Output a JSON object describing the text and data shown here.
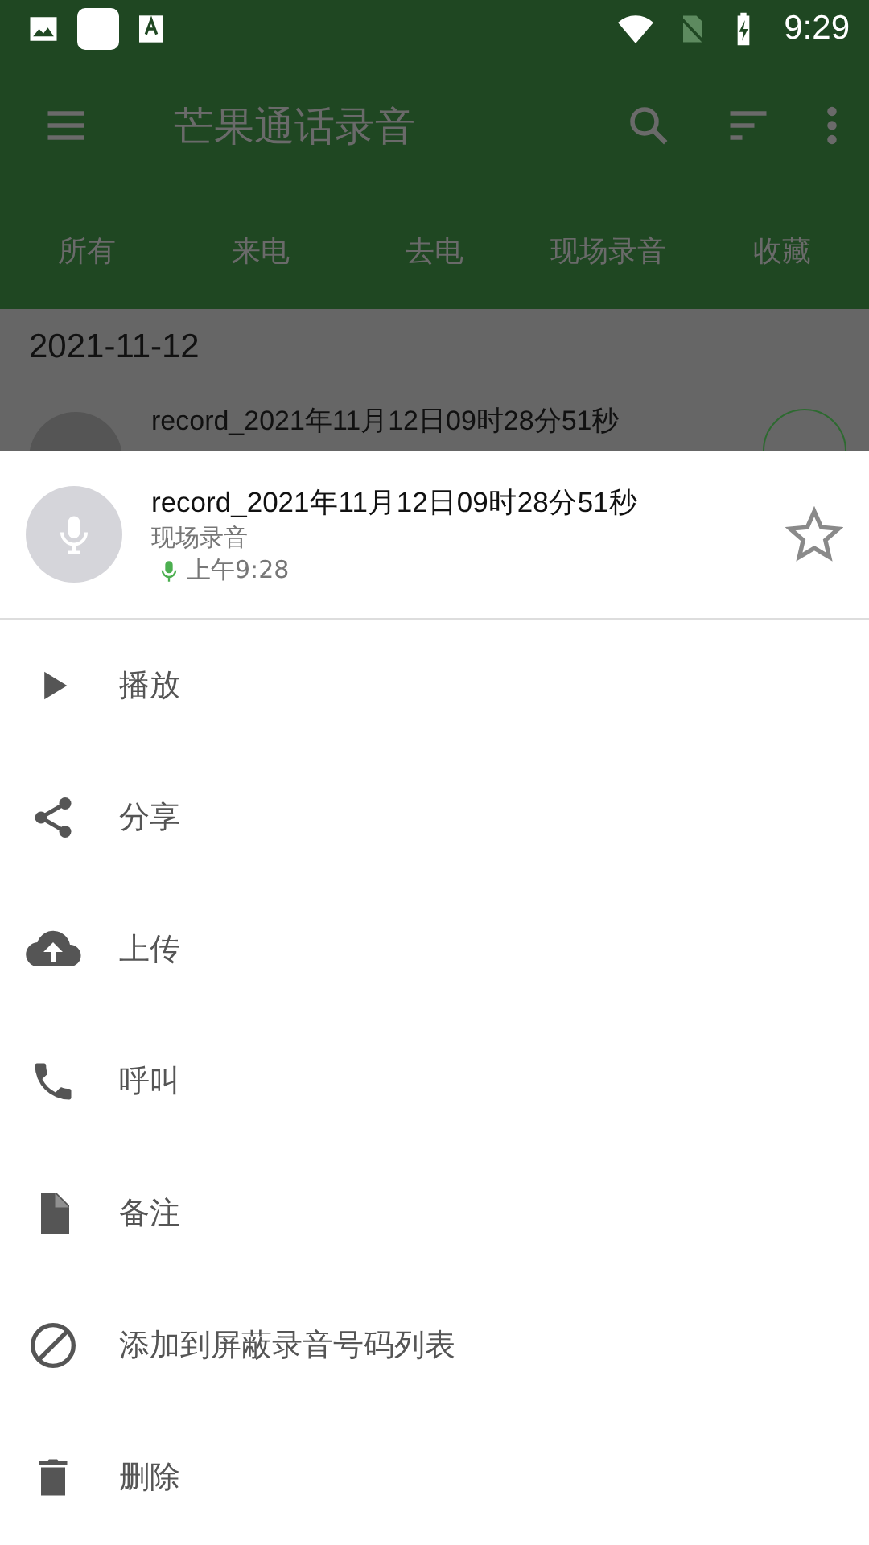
{
  "status_bar": {
    "time": "9:29"
  },
  "toolbar": {
    "title": "芒果通话录音"
  },
  "tabs": [
    {
      "label": "所有"
    },
    {
      "label": "来电"
    },
    {
      "label": "去电"
    },
    {
      "label": "现场录音"
    },
    {
      "label": "收藏"
    }
  ],
  "list": {
    "date": "2021-11-12",
    "item_title": "record_2021年11月12日09时28分51秒"
  },
  "sheet": {
    "title": "record_2021年11月12日09时28分51秒",
    "type": "现场录音",
    "time": "上午9:28",
    "favorite": false,
    "actions": [
      {
        "kind": "play",
        "label": "播放"
      },
      {
        "kind": "share",
        "label": "分享"
      },
      {
        "kind": "upload",
        "label": "上传"
      },
      {
        "kind": "call",
        "label": "呼叫"
      },
      {
        "kind": "note",
        "label": "备注"
      },
      {
        "kind": "block",
        "label": "添加到屏蔽录音号码列表"
      },
      {
        "kind": "delete",
        "label": "删除"
      }
    ]
  }
}
